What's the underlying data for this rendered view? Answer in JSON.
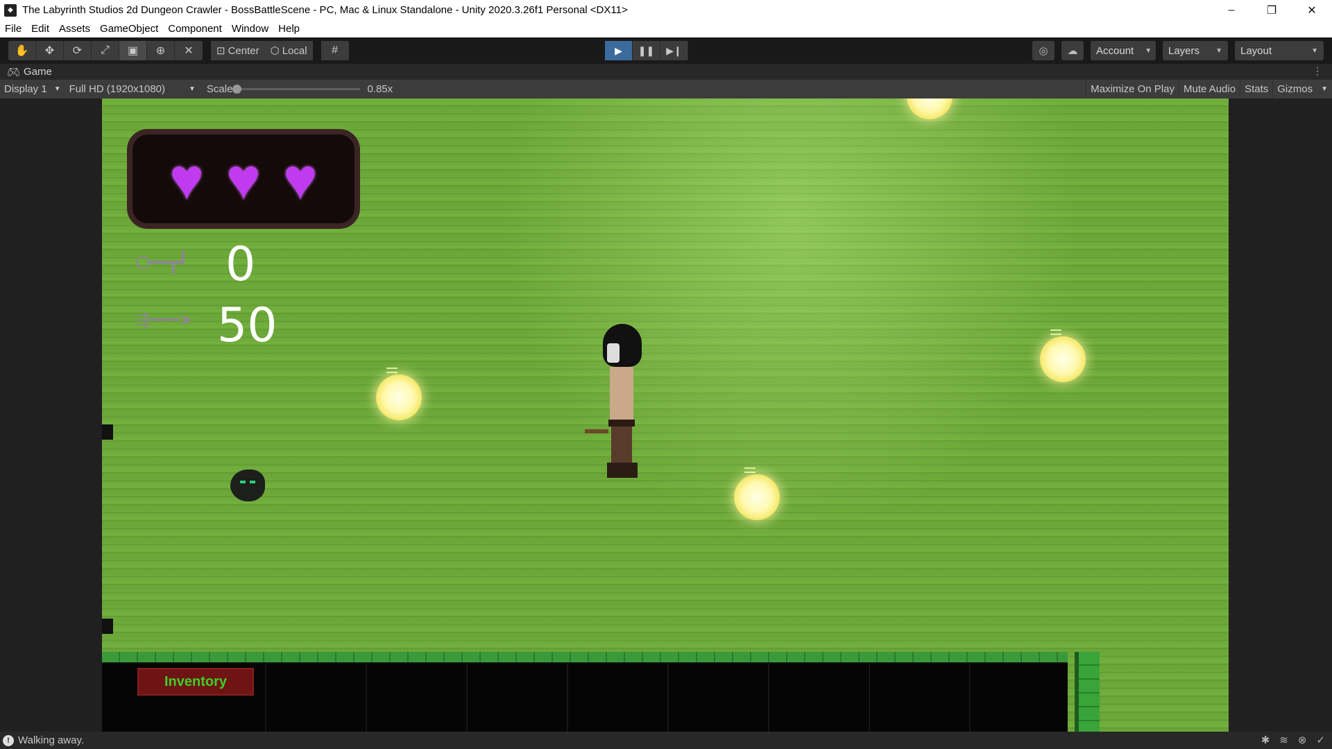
{
  "window": {
    "title": "The Labyrinth Studios 2d Dungeon Crawler - BossBattleScene - PC, Mac & Linux Standalone - Unity 2020.3.26f1 Personal <DX11>",
    "minimize": "–",
    "maximize": "❐",
    "close": "✕"
  },
  "menu": [
    "File",
    "Edit",
    "Assets",
    "GameObject",
    "Component",
    "Window",
    "Help"
  ],
  "toolbar": {
    "tools": [
      "hand-tool",
      "move-tool",
      "rotate-tool",
      "scale-tool",
      "rect-tool",
      "transform-tool",
      "custom-tool"
    ],
    "pivot_mode": "Center",
    "pivot_rotation": "Local",
    "account": "Account",
    "layers": "Layers",
    "layout": "Layout"
  },
  "tab": {
    "label": "Game"
  },
  "gamebar": {
    "display": "Display 1",
    "resolution": "Full HD (1920x1080)",
    "scale_label": "Scale",
    "scale_value": "0.85x",
    "maximize": "Maximize On Play",
    "mute": "Mute Audio",
    "stats": "Stats",
    "gizmos": "Gizmos"
  },
  "hud": {
    "hearts": [
      "♥",
      "♥",
      "♥"
    ],
    "key_count": "0",
    "arrow_count": "50",
    "inventory_label": "Inventory"
  },
  "status": {
    "message": "Walking away."
  },
  "colors": {
    "heart": "#c03bf0",
    "floor": "#6da93a",
    "inventory_text": "#3fcf28",
    "play_active": "#3a6b9c"
  }
}
